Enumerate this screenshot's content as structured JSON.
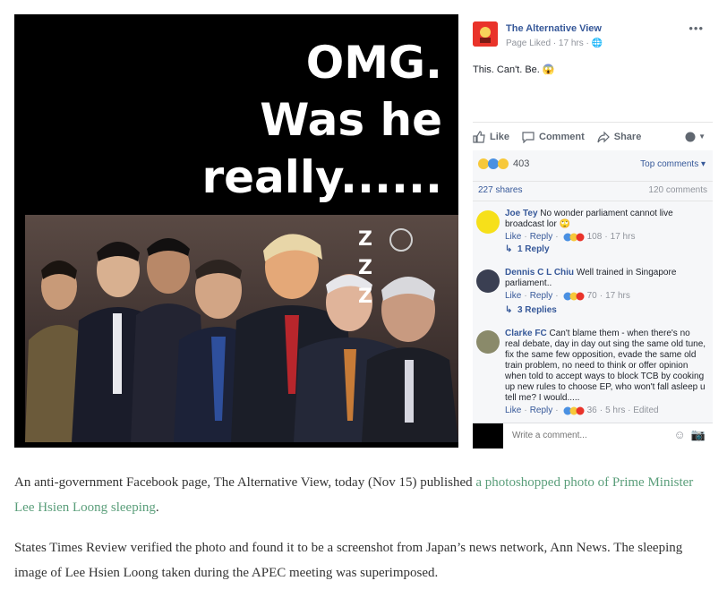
{
  "photo": {
    "headline": [
      "OMG.",
      "Was he",
      "really......"
    ],
    "zzz": [
      "Z",
      "Z",
      "Z"
    ]
  },
  "post": {
    "page_name": "The Alternative View",
    "page_meta": "Page Liked · 17 hrs · ",
    "text": "This. Can't. Be. ",
    "actions": {
      "like": "Like",
      "comment": "Comment",
      "share": "Share"
    },
    "reaction_count": "403",
    "sort_label": "Top comments ▾",
    "shares": "227 shares",
    "comments_count": "120 comments",
    "write_placeholder": "Write a comment..."
  },
  "comments": [
    {
      "name": "Joe Tey",
      "text": "No wonder parliament cannot live broadcast lor",
      "like": "Like",
      "reply": "Reply",
      "reactions": "108",
      "time": "17 hrs",
      "replies": "1 Reply",
      "avatar_color": "#f6e01a"
    },
    {
      "name": "Dennis C L Chiu",
      "text": "Well trained in Singapore parliament..",
      "like": "Like",
      "reply": "Reply",
      "reactions": "70",
      "time": "17 hrs",
      "replies": "3 Replies",
      "avatar_color": "#3a3f52"
    },
    {
      "name": "Clarke FC",
      "text": "Can't blame them - when there's no real debate, day in day out sing the same old tune, fix the same few opposition, evade the same old train problem, no need to think or offer opinion when told to accept ways to block TCB by cooking up new rules to choose EP, who won't fall asleep u tell me? I would.....",
      "like": "Like",
      "reply": "Reply",
      "reactions": "36",
      "time": "5 hrs · Edited",
      "avatar_color": "#8a8a6a"
    }
  ],
  "article": {
    "p1_before": "An anti-government Facebook page, The Alternative View, today (Nov 15) published ",
    "p1_link": "a photoshopped photo of Prime Minister Lee Hsien Loong sleeping",
    "p1_after": ".",
    "p2": "States Times Review verified the photo and found it to be a screenshot from Japan’s news network, Ann News. The sleeping image of Lee Hsien Loong taken during the APEC meeting was superimposed."
  },
  "colors": {
    "link": "#5a9e7a",
    "fb_blue": "#365899",
    "muted": "#90949c"
  }
}
